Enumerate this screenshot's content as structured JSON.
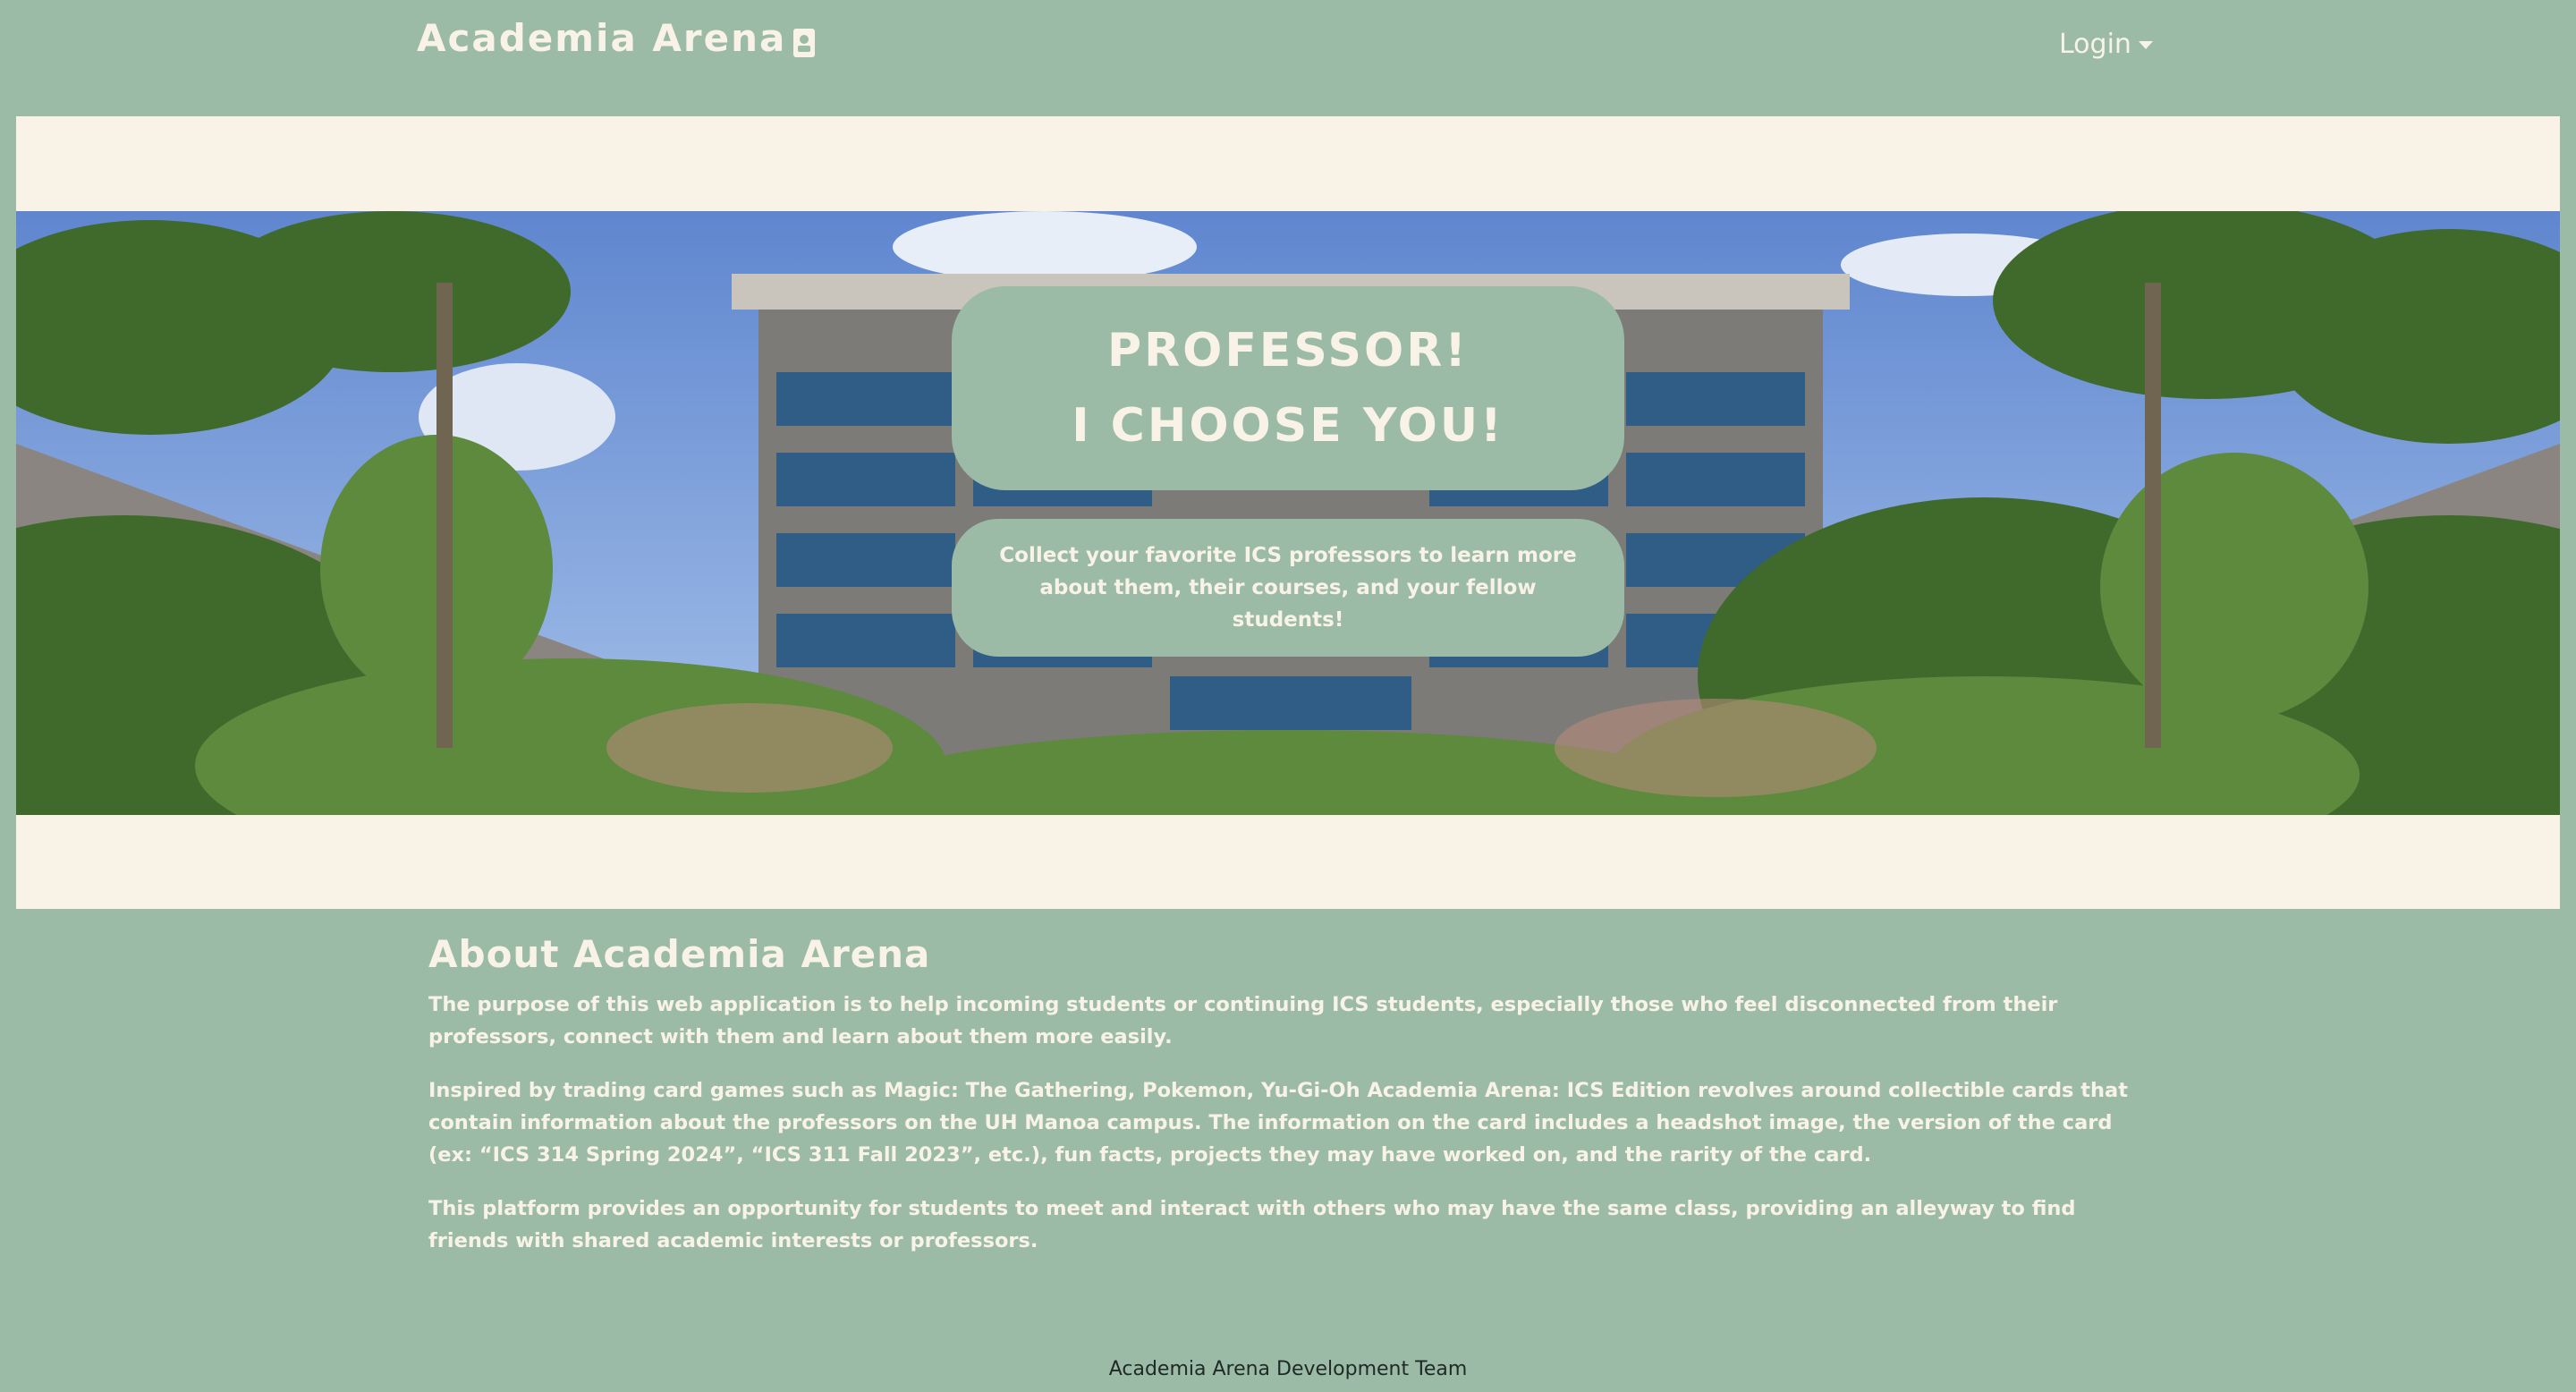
{
  "navbar": {
    "brand": "Academia Arena",
    "brand_icon": "id-card-icon",
    "login_label": "Login"
  },
  "hero": {
    "title_line1": "PROFESSOR!",
    "title_line2": "I CHOOSE YOU!",
    "subtitle": "Collect your favorite ICS professors to learn more about them, their courses, and your fellow students!",
    "image_description_icon": "campus-building-image"
  },
  "about": {
    "heading": "About Academia Arena",
    "paragraphs": [
      "The purpose of this web application is to help incoming students or continuing ICS students, especially those who feel disconnected from their professors, connect with them and learn about them more easily.",
      "Inspired by trading card games such as Magic: The Gathering, Pokemon, Yu-Gi-Oh Academia Arena: ICS Edition revolves around collectible cards that contain information about the professors on the UH Manoa campus. The information on the card includes a headshot image, the version of the card (ex: “ICS 314 Spring 2024”, “ICS 311 Fall 2023”, etc.), fun facts, projects they may have worked on, and the rarity of the card.",
      "This platform provides an opportunity for students to meet and interact with others who may have the same class, providing an alleyway to find friends with shared academic interests or professors."
    ]
  },
  "footer": {
    "text": "Academia Arena Development Team"
  },
  "colors": {
    "background": "#9bbba7",
    "cream": "#f8f3e6",
    "footer_text": "#1f2a24"
  }
}
